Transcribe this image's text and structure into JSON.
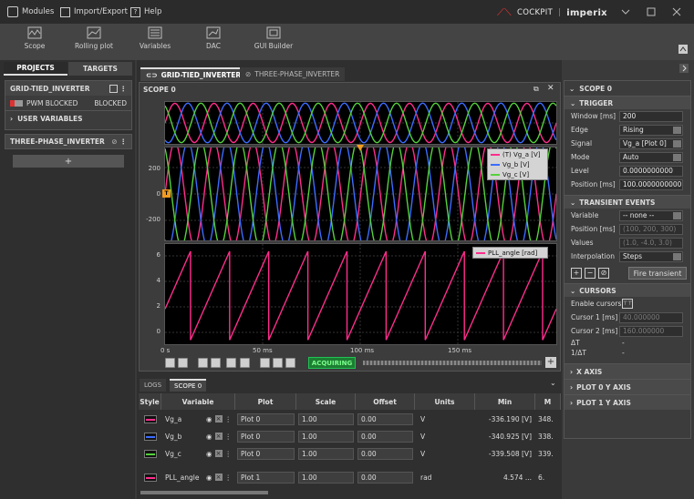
{
  "titlebar": {
    "modules": "Modules",
    "import_export": "Import/Export",
    "help": "Help",
    "brand_left": "COCKPIT",
    "brand_right": "imperix"
  },
  "ribbon": [
    "Scope",
    "Rolling plot",
    "Variables",
    "DAC",
    "GUI Builder"
  ],
  "left": {
    "tabs": [
      "PROJECTS",
      "TARGETS"
    ],
    "project1": {
      "name": "GRID-TIED_INVERTER",
      "status_label": "PWM BLOCKED",
      "status_value": "BLOCKED",
      "user_vars": "USER VARIABLES"
    },
    "project2": {
      "name": "THREE-PHASE_INVERTER"
    },
    "add": "+"
  },
  "center": {
    "tabs": [
      "GRID-TIED_INVERTER",
      "THREE-PHASE_INVERTER"
    ],
    "scope_title": "SCOPE 0",
    "plot0_yticks": [
      "200",
      "0",
      "-200"
    ],
    "plot1_yticks": [
      "6",
      "4",
      "2",
      "0"
    ],
    "xticks": [
      "0 s",
      "50 ms",
      "100 ms",
      "150 ms"
    ],
    "legend0": [
      "(T) Vg_a  [V]",
      "Vg_b  [V]",
      "Vg_c  [V]"
    ],
    "legend1": [
      "PLL_angle  [rad]"
    ],
    "trigger_marker": "T",
    "acquiring": "ACQUIRING"
  },
  "colors": {
    "vg_a": "#ff2d8c",
    "vg_b": "#3b6cff",
    "vg_c": "#55d13c",
    "pll": "#ff2d8c",
    "acquiring": "#21c255"
  },
  "chart_data": [
    {
      "type": "line",
      "ylim": [
        -300,
        300
      ],
      "xlim_ms": [
        0,
        200
      ],
      "series": [
        {
          "name": "Vg_a",
          "amplitude": 336,
          "freq_hz": 50,
          "phase_deg": 0
        },
        {
          "name": "Vg_b",
          "amplitude": 340,
          "freq_hz": 50,
          "phase_deg": -120
        },
        {
          "name": "Vg_c",
          "amplitude": 339,
          "freq_hz": 50,
          "phase_deg": 120
        }
      ],
      "yticks": [
        200,
        0,
        -200
      ],
      "xticks": [
        "0 s",
        "50 ms",
        "100 ms",
        "150 ms"
      ]
    },
    {
      "type": "line",
      "ylim": [
        -0.3,
        6.8
      ],
      "xlim_ms": [
        0,
        200
      ],
      "series": [
        {
          "name": "PLL_angle",
          "min": 0,
          "max": 6.2832,
          "freq_hz": 50,
          "shape": "sawtooth"
        }
      ],
      "yticks": [
        6,
        4,
        2,
        0
      ]
    }
  ],
  "bottom": {
    "tabs": [
      "LOGS",
      "SCOPE 0"
    ],
    "headers": [
      "Style",
      "Variable",
      "Plot",
      "Scale",
      "Offset",
      "Units",
      "Min",
      "M"
    ],
    "rows": [
      {
        "var": "Vg_a",
        "plot": "Plot 0",
        "scale": "1.00",
        "offset": "0.00",
        "units": "V",
        "min": "-336.190 [V]",
        "max": "348."
      },
      {
        "var": "Vg_b",
        "plot": "Plot 0",
        "scale": "1.00",
        "offset": "0.00",
        "units": "V",
        "min": "-340.925 [V]",
        "max": "338."
      },
      {
        "var": "Vg_c",
        "plot": "Plot 0",
        "scale": "1.00",
        "offset": "0.00",
        "units": "V",
        "min": "-339.508 [V]",
        "max": "339."
      },
      {
        "var": "PLL_angle",
        "plot": "Plot 1",
        "scale": "1.00",
        "offset": "0.00",
        "units": "rad",
        "min": "4.574 ...",
        "max": "6."
      }
    ]
  },
  "right": {
    "title": "SCOPE 0",
    "trigger": {
      "header": "TRIGGER",
      "window_label": "Window [ms]",
      "window": "200",
      "edge_label": "Edge",
      "edge": "Rising",
      "signal_label": "Signal",
      "signal": "Vg_a [Plot 0]",
      "mode_label": "Mode",
      "mode": "Auto",
      "level_label": "Level",
      "level": "0.0000000000",
      "position_label": "Position [ms]",
      "position": "100.0000000000"
    },
    "transient": {
      "header": "TRANSIENT EVENTS",
      "variable_label": "Variable",
      "variable": "-- none --",
      "position_label": "Position [ms]",
      "position_ph": "(100, 200, 300)",
      "values_label": "Values",
      "values_ph": "(1.0, -4.0, 3.0)",
      "interp_label": "Interpolation",
      "interp": "Steps",
      "fire": "Fire transient"
    },
    "cursors": {
      "header": "CURSORS",
      "enable": "Enable cursors",
      "c1_label": "Cursor 1 [ms]",
      "c1": "40.000000",
      "c2_label": "Cursor 2 [ms]",
      "c2": "160.000000",
      "dt_label": "ΔT",
      "dt": "-",
      "inv_label": "1/ΔT",
      "inv": "-"
    },
    "xaxis": "X AXIS",
    "plot0": "PLOT 0 Y AXIS",
    "plot1": "PLOT 1 Y AXIS"
  }
}
